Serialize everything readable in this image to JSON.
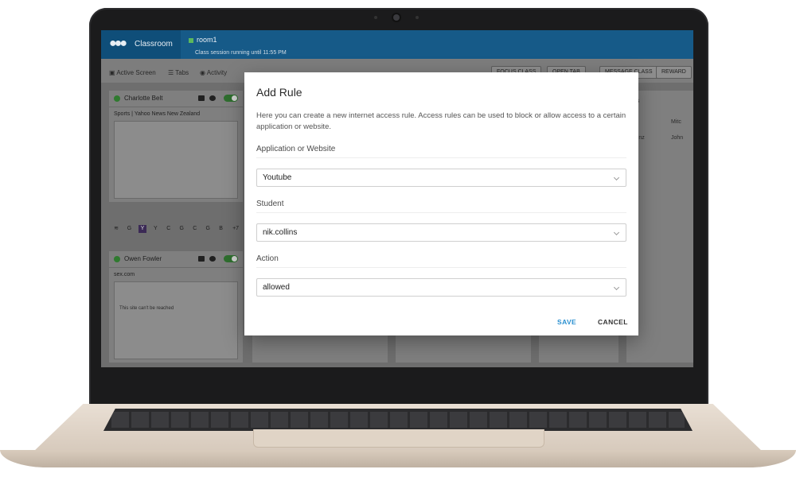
{
  "app": {
    "name": "Classroom",
    "room": "room1",
    "session_status": "Class session running until 11:55 PM"
  },
  "toolbar": {
    "tabs": [
      {
        "label": "Active Screen"
      },
      {
        "label": "Tabs"
      },
      {
        "label": "Activity"
      }
    ],
    "actions": [
      {
        "label": "FOCUS CLASS"
      },
      {
        "label": "OPEN TAB"
      },
      {
        "label": "MESSAGE CLASS"
      },
      {
        "label": "REWARD"
      }
    ]
  },
  "students": [
    {
      "name": "Charlotte Belt",
      "tab_title": "Sports | Yahoo News New Zealand",
      "tab_strip": [
        "G",
        "Y",
        "Y",
        "C",
        "G",
        "C",
        "G",
        "B",
        "+7"
      ]
    },
    {
      "name": "Owen Fowler",
      "tab_title": "sex.com",
      "page_message": "This site can't be reached"
    }
  ],
  "side_panel": {
    "title": "ies",
    "rows": [
      {
        "left": "t",
        "right": "Mitc"
      },
      {
        "left": "co.nz",
        "right": "John"
      }
    ]
  },
  "modal": {
    "title": "Add Rule",
    "description": "Here you can create a new internet access rule. Access rules can be used to block or allow access to a certain application or website.",
    "fields": {
      "app": {
        "label": "Application or Website",
        "value": "Youtube"
      },
      "student": {
        "label": "Student",
        "value": "nik.collins"
      },
      "action": {
        "label": "Action",
        "value": "allowed"
      }
    },
    "save_label": "SAVE",
    "cancel_label": "CANCEL"
  },
  "colors": {
    "accent": "#2a90d0",
    "header": "#165a88",
    "status_ok": "#2f7a2f"
  }
}
